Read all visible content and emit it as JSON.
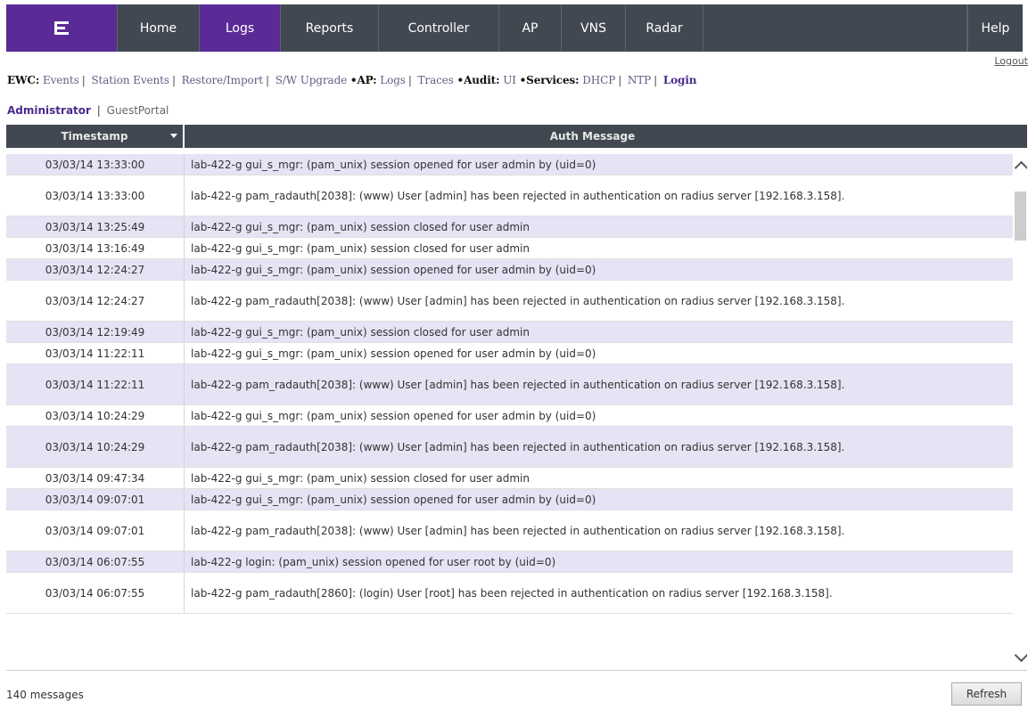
{
  "nav": {
    "tabs": [
      "Home",
      "Logs",
      "Reports",
      "Controller",
      "AP",
      "VNS",
      "Radar"
    ],
    "active": "Logs",
    "help": "Help",
    "logout": "Logout"
  },
  "subnav": {
    "ewc_label": "EWC:",
    "ewc_links": [
      "Events",
      "Station Events",
      "Restore/Import",
      "S/W Upgrade"
    ],
    "ap_label": "•AP:",
    "ap_links": [
      "Logs",
      "Traces"
    ],
    "audit_label": "•Audit:",
    "audit_links": [
      "UI"
    ],
    "services_label": "•Services:",
    "services_links": [
      "DHCP",
      "NTP"
    ],
    "current": "Login"
  },
  "tabs": {
    "first": "Administrator",
    "second": "GuestPortal"
  },
  "table": {
    "col_timestamp": "Timestamp",
    "col_message": "Auth  Message",
    "rows": [
      {
        "ts": "03/03/14 13:33:00",
        "msg": "lab-422-g gui_s_mgr: (pam_unix) session opened for user admin by (uid=0)"
      },
      {
        "ts": "03/03/14 13:33:00",
        "msg": "lab-422-g pam_radauth[2038]: (www) User [admin] has been rejected in authentication on radius server [192.168.3.158]."
      },
      {
        "ts": "03/03/14 13:25:49",
        "msg": "lab-422-g gui_s_mgr: (pam_unix) session closed for user admin"
      },
      {
        "ts": "03/03/14 13:16:49",
        "msg": "lab-422-g gui_s_mgr: (pam_unix) session closed for user admin"
      },
      {
        "ts": "03/03/14 12:24:27",
        "msg": "lab-422-g gui_s_mgr: (pam_unix) session opened for user admin by (uid=0)"
      },
      {
        "ts": "03/03/14 12:24:27",
        "msg": "lab-422-g pam_radauth[2038]: (www) User [admin] has been rejected in authentication on radius server [192.168.3.158]."
      },
      {
        "ts": "03/03/14 12:19:49",
        "msg": "lab-422-g gui_s_mgr: (pam_unix) session closed for user admin"
      },
      {
        "ts": "03/03/14 11:22:11",
        "msg": "lab-422-g gui_s_mgr: (pam_unix) session opened for user admin by (uid=0)"
      },
      {
        "ts": "03/03/14 11:22:11",
        "msg": "lab-422-g pam_radauth[2038]: (www) User [admin] has been rejected in authentication on radius server [192.168.3.158]."
      },
      {
        "ts": "03/03/14 10:24:29",
        "msg": "lab-422-g gui_s_mgr: (pam_unix) session opened for user admin by (uid=0)"
      },
      {
        "ts": "03/03/14 10:24:29",
        "msg": "lab-422-g pam_radauth[2038]: (www) User [admin] has been rejected in authentication on radius server [192.168.3.158]."
      },
      {
        "ts": "03/03/14 09:47:34",
        "msg": "lab-422-g gui_s_mgr: (pam_unix) session closed for user admin"
      },
      {
        "ts": "03/03/14 09:07:01",
        "msg": "lab-422-g gui_s_mgr: (pam_unix) session opened for user admin by (uid=0)"
      },
      {
        "ts": "03/03/14 09:07:01",
        "msg": "lab-422-g pam_radauth[2038]: (www) User [admin] has been rejected in authentication on radius server [192.168.3.158]."
      },
      {
        "ts": "03/03/14 06:07:55",
        "msg": "lab-422-g login: (pam_unix) session opened for user root by (uid=0)"
      },
      {
        "ts": "03/03/14 06:07:55",
        "msg": "lab-422-g pam_radauth[2860]: (login) User [root] has been rejected in authentication on radius server [192.168.3.158]."
      }
    ]
  },
  "footer": {
    "count": "140 messages",
    "refresh": "Refresh"
  }
}
